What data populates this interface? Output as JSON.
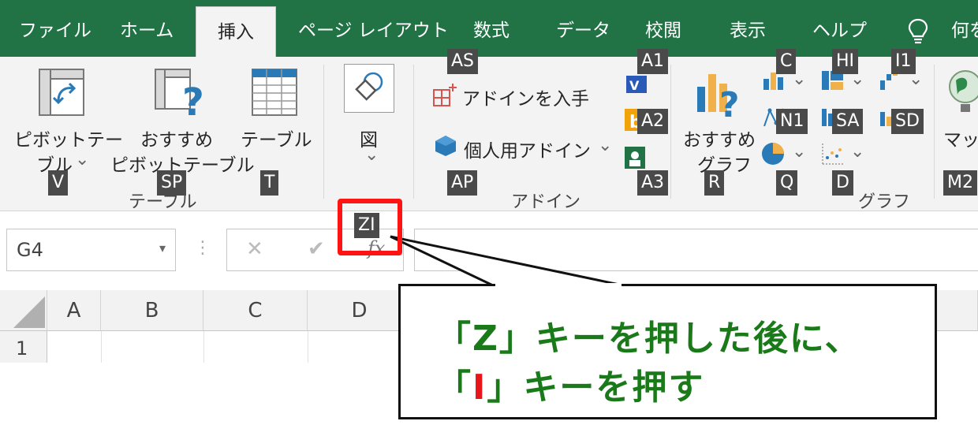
{
  "tabs": [
    {
      "label": "ファイル",
      "active": false
    },
    {
      "label": "ホーム",
      "active": false
    },
    {
      "label": "挿入",
      "active": true
    },
    {
      "label": "ページ レイアウト",
      "active": false
    },
    {
      "label": "数式",
      "active": false
    },
    {
      "label": "データ",
      "active": false
    },
    {
      "label": "校閲",
      "active": false
    },
    {
      "label": "表示",
      "active": false
    },
    {
      "label": "ヘルプ",
      "active": false
    },
    {
      "label": "何を",
      "active": false
    }
  ],
  "ribbon": {
    "pivot_line1": "ピボットテー",
    "pivot_line2": "ブル",
    "rec_pivot_line1": "おすすめ",
    "rec_pivot_line2": "ピボットテーブル",
    "table": "テーブル",
    "shapes": "図",
    "get_addins": "アドインを入手",
    "personal_addins": "個人用アドイン",
    "rec_chart_line1": "おすすめ",
    "rec_chart_line2": "グラフ",
    "maps": "マッフ",
    "group_table": "テーブル",
    "group_addins": "アドイン",
    "group_charts": "グラフ",
    "dropdown_glyph": "⌄"
  },
  "keytips": {
    "v": "V",
    "sp": "SP",
    "t": "T",
    "zi": "ZI",
    "as": "AS",
    "ap": "AP",
    "a1": "A1",
    "a2": "A2",
    "a3": "A3",
    "r": "R",
    "c": "C",
    "hi": "HI",
    "i1": "I1",
    "n1": "N1",
    "sa": "SA",
    "sd": "SD",
    "q": "Q",
    "d": "D",
    "m2": "M2"
  },
  "formula_bar": {
    "name_box": "G4",
    "cancel": "✕",
    "enter": "✔",
    "fx": "fx",
    "dots": "⋮",
    "name_dropdown": "▾"
  },
  "grid": {
    "columns": [
      "A",
      "B",
      "C",
      "D"
    ],
    "rows": [
      "1"
    ]
  },
  "annotation": {
    "line1_open": "「",
    "line1_key": "Z",
    "line1_rest": "」キーを押した後に、",
    "line2_open": "「",
    "line2_key": "I",
    "line2_rest": "」キーを押す"
  },
  "colors": {
    "ribbon_green": "#217346",
    "keytip_bg": "#4a4a4a",
    "highlight_red": "#ff1414",
    "annotation_green": "#1a7a1a",
    "annotation_red": "#e8151b"
  }
}
